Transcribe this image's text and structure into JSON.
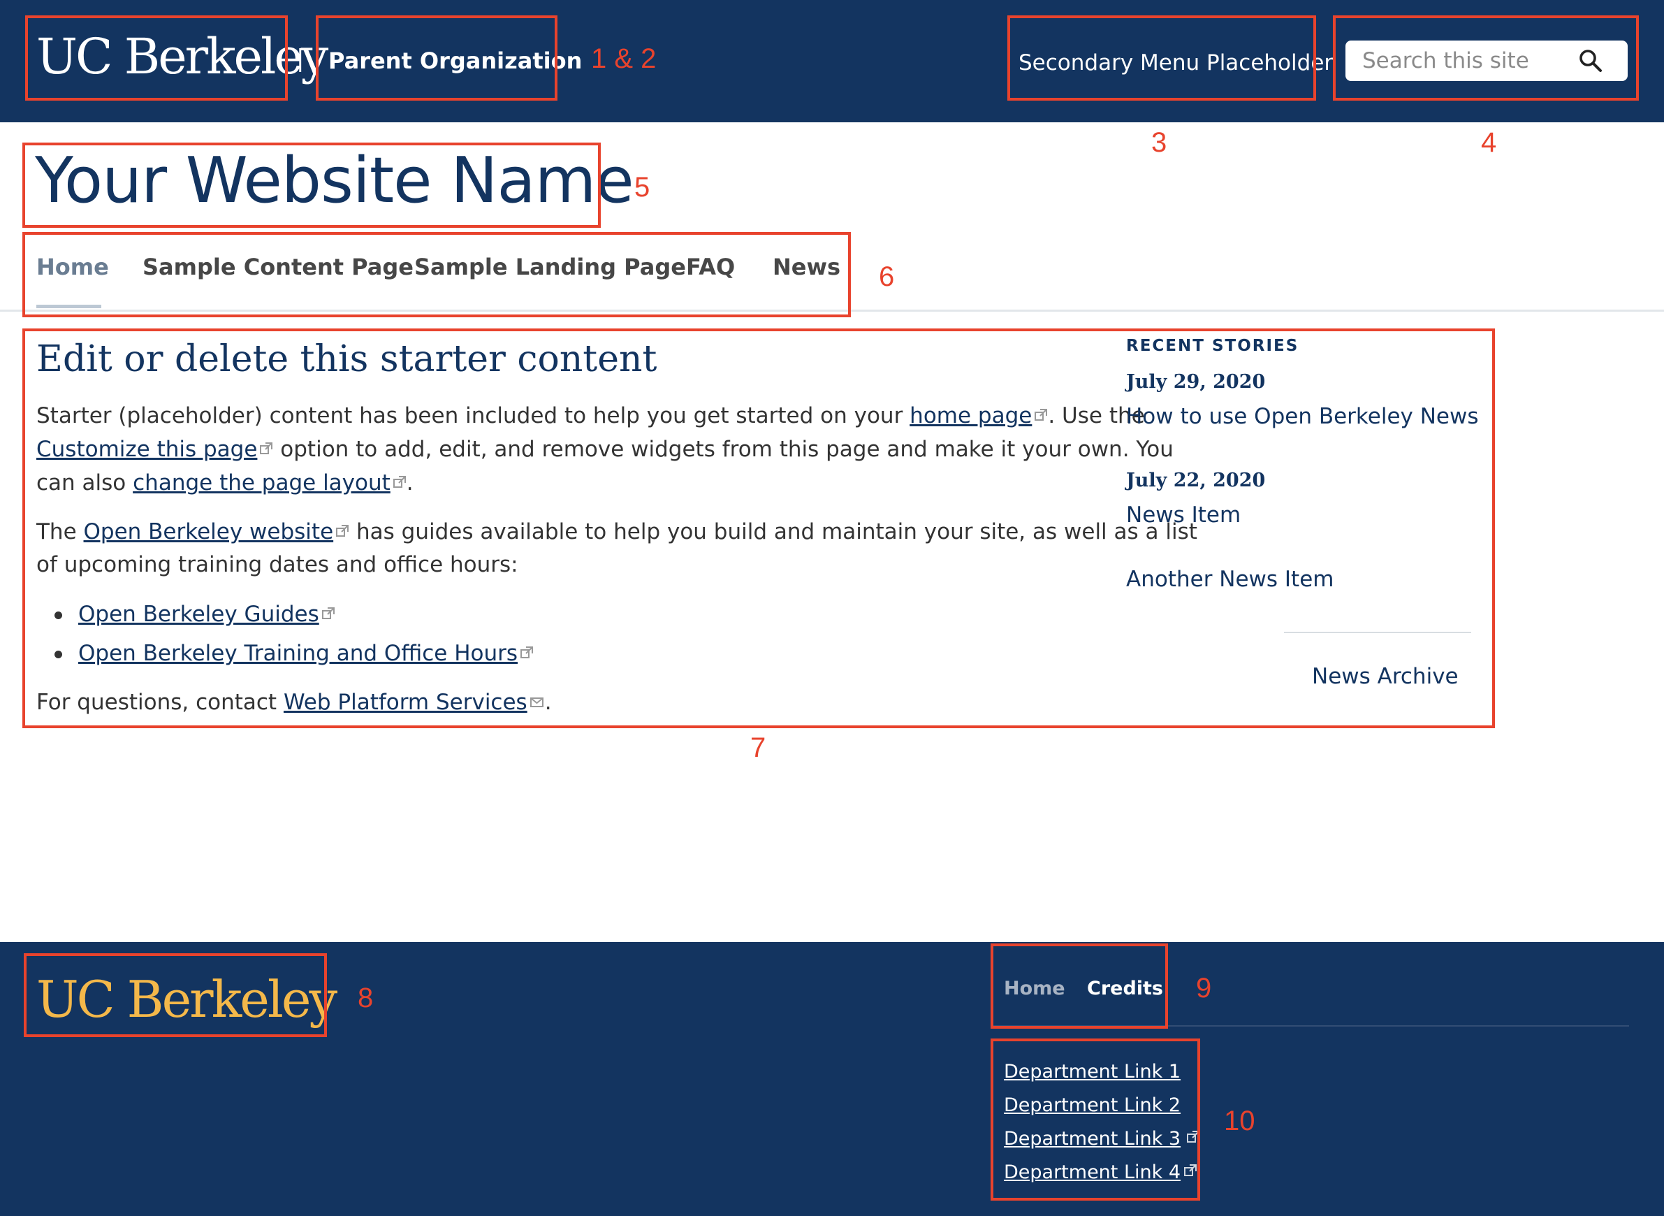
{
  "header": {
    "logo_text": "UC Berkeley",
    "divider": "|",
    "parent_org": "Parent Organization",
    "secondary_menu": "Secondary Menu Placeholder",
    "search_placeholder": "Search this site",
    "search_icon": "search-icon"
  },
  "site": {
    "name": "Your Website Name"
  },
  "nav": {
    "items": [
      {
        "label": "Home",
        "active": true
      },
      {
        "label": "Sample Content Page"
      },
      {
        "label": "Sample Landing Page"
      },
      {
        "label": "FAQ"
      },
      {
        "label": "News"
      }
    ]
  },
  "main": {
    "heading": "Edit or delete this starter content",
    "p1": {
      "t1": "Starter (placeholder) content has been included to help you get started on your ",
      "link1": "home page",
      "t2": ". Use the",
      "link2": "Customize this page",
      "t3": " option to add, edit, and remove widgets from this page and make it your own. You",
      "t4": "can also ",
      "link3": "change the page layout",
      "t5": "."
    },
    "p2": {
      "t1": "The ",
      "link1": "Open Berkeley website",
      "t2": " has guides available to help you build and maintain your site, as well as a list",
      "t3": "of upcoming training dates and office hours:"
    },
    "list": [
      "Open Berkeley Guides",
      "Open Berkeley Training and Office Hours"
    ],
    "p3": {
      "t1": "For questions, contact ",
      "link1": "Web Platform Services",
      "t2": "."
    }
  },
  "sidebar": {
    "title": "RECENT STORIES",
    "stories": [
      {
        "date": "July 29, 2020",
        "title": "How to use Open Berkeley News"
      },
      {
        "date": "July 22, 2020",
        "title": "News Item"
      },
      {
        "date": "",
        "title": "Another News Item"
      }
    ],
    "archive_label": "News Archive"
  },
  "footer": {
    "logo_text": "UC Berkeley",
    "nav": [
      "Home",
      "Credits"
    ],
    "dept_links": [
      "Department Link 1",
      "Department Link 2",
      "Department Link 3",
      "Department Link 4"
    ]
  },
  "annotations": [
    "1 & 2",
    "3",
    "4",
    "5",
    "6",
    "7",
    "8",
    "9",
    "10"
  ],
  "colors": {
    "navy": "#133460",
    "gold": "#f4b84a",
    "annotation_red": "#e8432d",
    "nav_text": "#474747",
    "nav_active": "#6a7d92"
  }
}
